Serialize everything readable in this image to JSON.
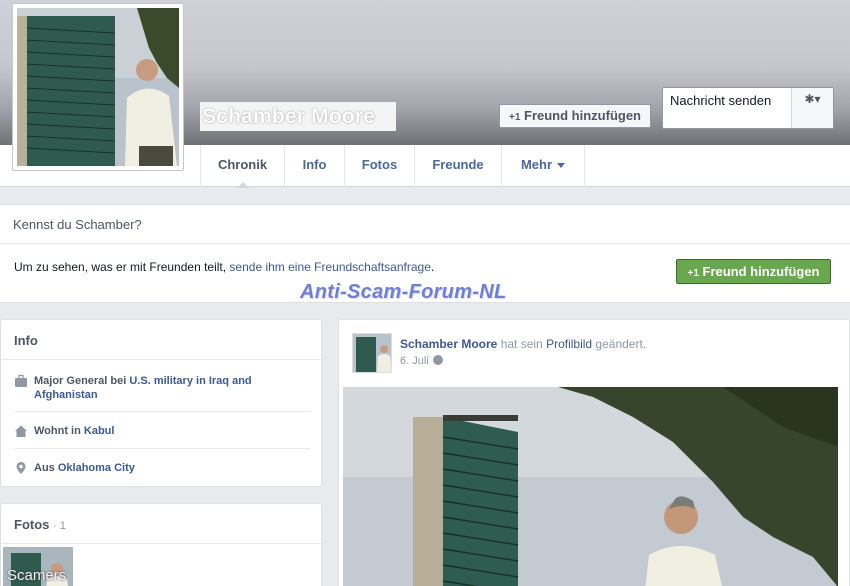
{
  "profile": {
    "name": "Schamber Moore",
    "add_friend_label": "Freund hinzufügen",
    "add_friend_prefix": "+1",
    "message_label": "Nachricht senden"
  },
  "tabs": [
    {
      "label": "Chronik"
    },
    {
      "label": "Info"
    },
    {
      "label": "Fotos"
    },
    {
      "label": "Freunde"
    },
    {
      "label": "Mehr"
    }
  ],
  "know": {
    "heading": "Kennst du Schamber?",
    "text_before": "Um zu sehen, was er mit Freunden teilt, ",
    "link": "sende ihm eine Freundschaftsanfrage",
    "text_after": ".",
    "button_prefix": "+1",
    "button_label": "Freund hinzufügen"
  },
  "watermark": "Anti-Scam-Forum-NL",
  "info": {
    "title": "Info",
    "job_prefix": "Major General bei ",
    "job_employer": "U.S. military in Iraq and Afghanistan",
    "lives_prefix": "Wohnt in ",
    "lives_place": "Kabul",
    "from_prefix": "Aus ",
    "from_place": "Oklahoma City"
  },
  "fotos": {
    "title": "Fotos",
    "count": "· 1",
    "thumb_label": "Scamers"
  },
  "post": {
    "author": "Schamber Moore",
    "action": " hat sein ",
    "object": "Profilbild",
    "action_after": " geändert.",
    "date": "6. Juli"
  },
  "colors": {
    "link": "#3b5998",
    "green_button": "#69a74e",
    "watermark": "#6f7fd6"
  }
}
